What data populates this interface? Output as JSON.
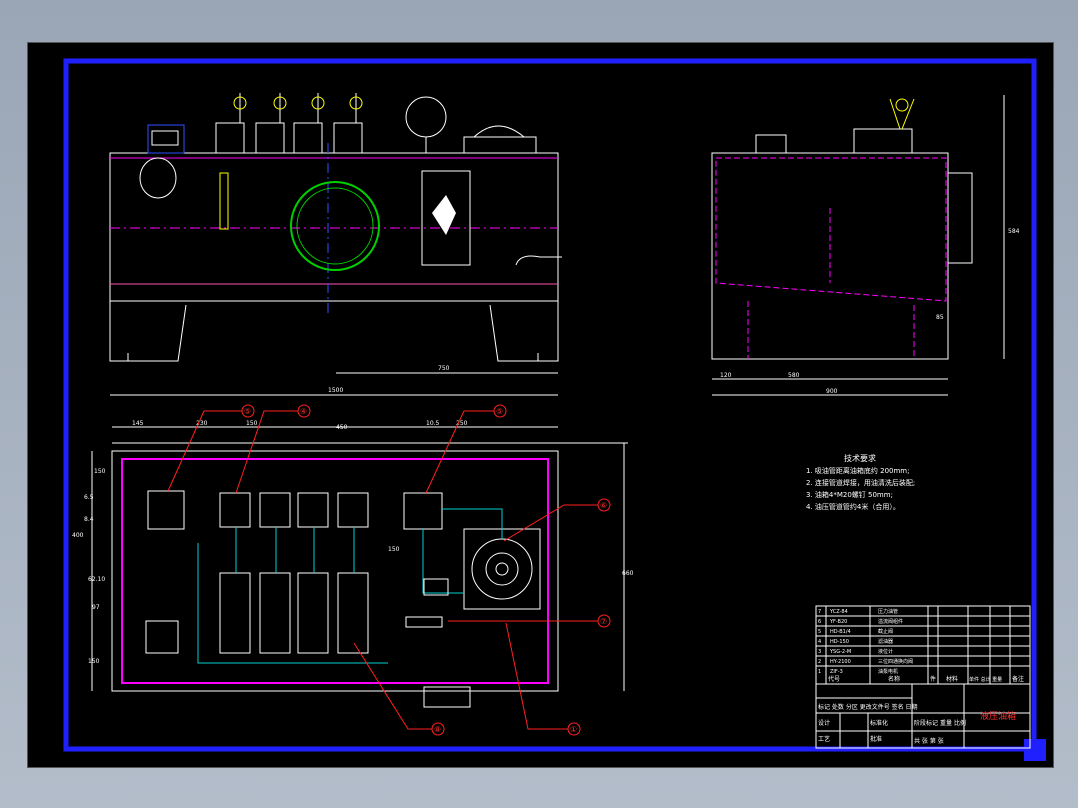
{
  "drawing": {
    "notes": {
      "title": "技术要求",
      "items": [
        "1. 吸油管距离油箱底约 200mm;",
        "2. 连接管道焊接，用油清洗后装配;",
        "3. 油箱4*M20螺钉 50mm;",
        "4. 油压管道管约4米（合用）。"
      ]
    },
    "dimensions": {
      "front_total": "1500",
      "front_partial": "750",
      "side_total": "900",
      "side_a": "120",
      "side_b": "580",
      "side_height": "584",
      "side_small": "85",
      "plan_top_a": "145",
      "plan_top_b": "230",
      "plan_top_c": "150",
      "plan_top_d": "450",
      "plan_top_e": "10.5",
      "plan_top_f": "250",
      "plan_left_a": "150",
      "plan_left_b": "400",
      "plan_left_c": "6.5",
      "plan_left_d": "8.4",
      "plan_left_e": "62.10",
      "plan_left_f": "97",
      "plan_left_g": "150",
      "plan_right": "660",
      "plan_mid": "150"
    },
    "balloons": [
      "⑤",
      "④",
      "⑤",
      "⑥",
      "⑦",
      "⑧",
      "①"
    ],
    "title_block": {
      "drawing_name": "液压油箱",
      "rows": [
        {
          "no": "7",
          "code": "YCZ-84",
          "name": "压力油管"
        },
        {
          "no": "6",
          "code": "YF-B20",
          "name": "溢流阀组件"
        },
        {
          "no": "5",
          "code": "HD-B1/4",
          "name": "截止阀"
        },
        {
          "no": "4",
          "code": "HD-150",
          "name": "滤油器"
        },
        {
          "no": "3",
          "code": "YSG-2-M",
          "name": "液位计"
        },
        {
          "no": "2",
          "code": "HY-2100",
          "name": "三位四通换向阀"
        },
        {
          "no": "1",
          "code": "ZIF-3",
          "name": "油泵电机"
        }
      ],
      "header": {
        "code": "代号",
        "name": "名称",
        "qty": "件",
        "material": "材料",
        "weight": "单件 总计 重量",
        "remark": "备注"
      },
      "labels": {
        "designer": "设计",
        "process": "工艺",
        "approve": "批准",
        "std": "标准化",
        "stage": "阶段标记",
        "weight": "重量",
        "scale": "比例",
        "sheet": "共 张 第 张",
        "revision": "标记 处数 分区 更改文件号 签名 日期"
      }
    }
  }
}
